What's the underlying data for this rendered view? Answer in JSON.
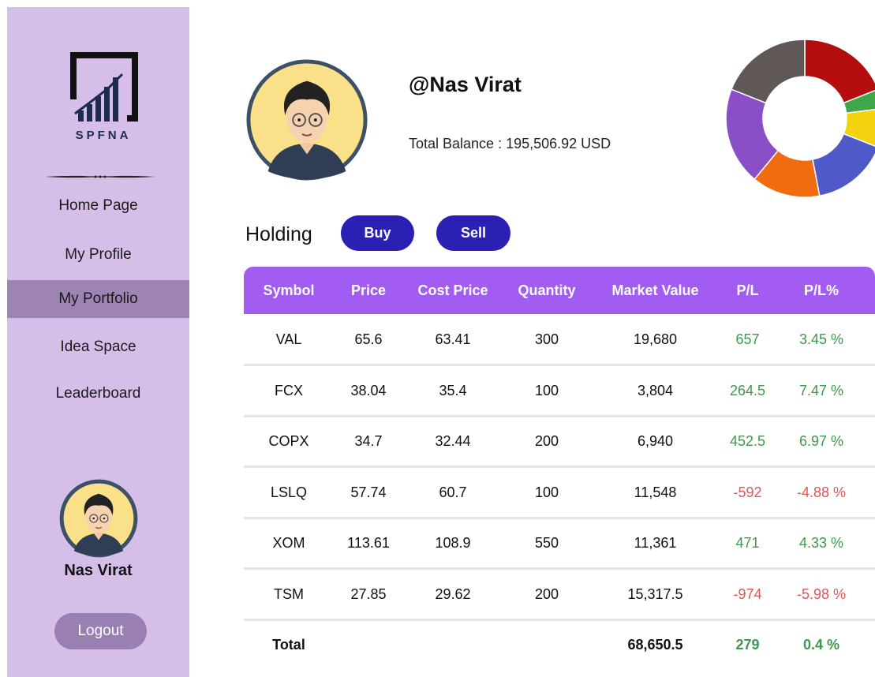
{
  "brand": {
    "logo_text": "SPFNA"
  },
  "sidebar": {
    "nav": [
      {
        "label": "Home Page"
      },
      {
        "label": "My Profile"
      },
      {
        "label": "My Portfolio"
      },
      {
        "label": "Idea Space"
      },
      {
        "label": "Leaderboard"
      }
    ],
    "active_index": 2,
    "user_name": "Nas Virat",
    "logout_label": "Logout"
  },
  "profile": {
    "handle": "@Nas Virat",
    "balance_text": "Total Balance : 195,506.92 USD"
  },
  "holding": {
    "title": "Holding",
    "buy_label": "Buy",
    "sell_label": "Sell"
  },
  "table": {
    "columns": [
      "Symbol",
      "Price",
      "Cost Price",
      "Quantity",
      "Market Value",
      "P/L",
      "P/L%"
    ],
    "rows": [
      {
        "symbol": "VAL",
        "price": "65.6",
        "cost": "63.41",
        "qty": "300",
        "mv": "19,680",
        "pl": "657",
        "plpct": "3.45 %",
        "status": "pos"
      },
      {
        "symbol": "FCX",
        "price": "38.04",
        "cost": "35.4",
        "qty": "100",
        "mv": "3,804",
        "pl": "264.5",
        "plpct": "7.47 %",
        "status": "pos"
      },
      {
        "symbol": "COPX",
        "price": "34.7",
        "cost": "32.44",
        "qty": "200",
        "mv": "6,940",
        "pl": "452.5",
        "plpct": "6.97 %",
        "status": "pos"
      },
      {
        "symbol": "LSLQ",
        "price": "57.74",
        "cost": "60.7",
        "qty": "100",
        "mv": "11,548",
        "pl": "-592",
        "plpct": "-4.88 %",
        "status": "neg"
      },
      {
        "symbol": "XOM",
        "price": "113.61",
        "cost": "108.9",
        "qty": "550",
        "mv": "11,361",
        "pl": "471",
        "plpct": "4.33 %",
        "status": "pos"
      },
      {
        "symbol": "TSM",
        "price": "27.85",
        "cost": "29.62",
        "qty": "200",
        "mv": "15,317.5",
        "pl": "-974",
        "plpct": "-5.98 %",
        "status": "neg"
      }
    ],
    "total": {
      "label": "Total",
      "mv": "68,650.5",
      "pl": "279",
      "plpct": "0.4 %",
      "status": "pos"
    }
  },
  "allocation_chart": {
    "type": "donut",
    "slices": [
      {
        "color": "#b30d0d",
        "value": 19
      },
      {
        "color": "#3fa64a",
        "value": 4
      },
      {
        "color": "#f3d20f",
        "value": 8
      },
      {
        "color": "#5059c8",
        "value": 16
      },
      {
        "color": "#f06c0f",
        "value": 14
      },
      {
        "color": "#8a4fc7",
        "value": 20
      },
      {
        "color": "#605857",
        "value": 19
      }
    ]
  },
  "colors": {
    "sidebar_bg": "#d5bfe8",
    "active_nav": "#9d84b5",
    "table_header": "#a35cf2",
    "button": "#2a21b4",
    "positive": "#3c9a4a",
    "negative": "#e05555"
  }
}
